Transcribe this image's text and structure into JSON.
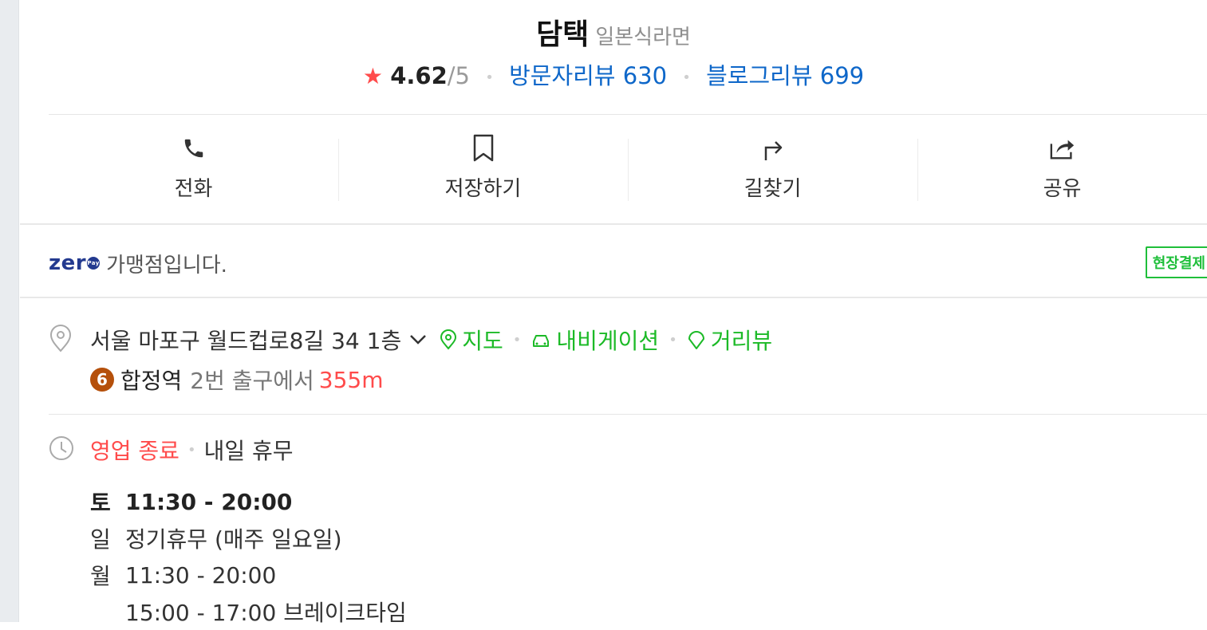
{
  "place": {
    "name": "담택",
    "category": "일본식라면",
    "rating": "4.62",
    "rating_max": "/5",
    "visitor_reviews_label": "방문자리뷰 630",
    "blog_reviews_label": "블로그리뷰 699"
  },
  "actions": [
    {
      "label": "전화",
      "icon": "phone-icon"
    },
    {
      "label": "저장하기",
      "icon": "bookmark-icon"
    },
    {
      "label": "길찾기",
      "icon": "directions-icon"
    },
    {
      "label": "공유",
      "icon": "share-icon"
    }
  ],
  "zeropay": {
    "logo_text": "zer",
    "pay_text": "Pay",
    "text": "가맹점입니다.",
    "badge": "현장결제"
  },
  "address": {
    "text": "서울 마포구 월드컵로8길 34 1층",
    "map_label": "지도",
    "navigation_label": "내비게이션",
    "street_view_label": "거리뷰",
    "subway_line": "6",
    "station": "합정역",
    "exit": "2번 출구에서",
    "distance": "355m"
  },
  "hours": {
    "status": "영업 종료",
    "next": "내일 휴무",
    "rows": [
      {
        "day": "토",
        "time": "11:30 - 20:00"
      },
      {
        "day": "일",
        "time": "정기휴무 (매주 일요일)"
      },
      {
        "day": "월",
        "time": "11:30 - 20:00"
      }
    ],
    "break_time": "15:00 - 17:00 브레이크타임"
  },
  "colors": {
    "link_blue": "#0e67c9",
    "green": "#1cba27",
    "red": "#ff4b4b",
    "zeropay_navy": "#233a8f",
    "line6": "#b5500b"
  }
}
